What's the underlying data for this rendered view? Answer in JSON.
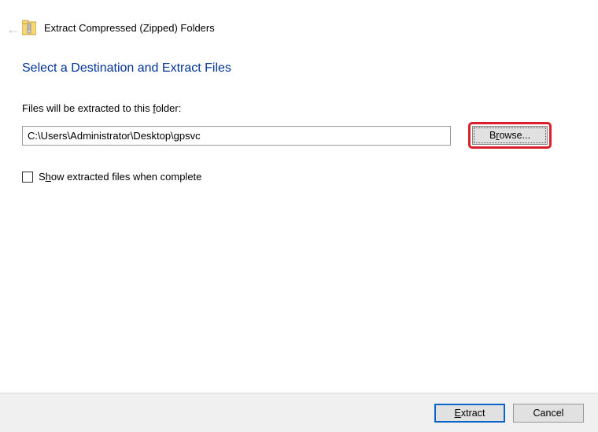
{
  "header": {
    "title": "Extract Compressed (Zipped) Folders"
  },
  "main": {
    "instruction": "Select a Destination and Extract Files",
    "folder_label_pre": "Files will be extracted to this ",
    "folder_label_underline": "f",
    "folder_label_post": "older:",
    "path_value": "C:\\Users\\Administrator\\Desktop\\gpsvc",
    "browse_pre": "B",
    "browse_underline": "r",
    "browse_post": "owse...",
    "checkbox_pre": "S",
    "checkbox_underline": "h",
    "checkbox_post": "ow extracted files when complete",
    "checkbox_checked": false
  },
  "footer": {
    "extract_underline": "E",
    "extract_post": "xtract",
    "cancel_label": "Cancel"
  }
}
